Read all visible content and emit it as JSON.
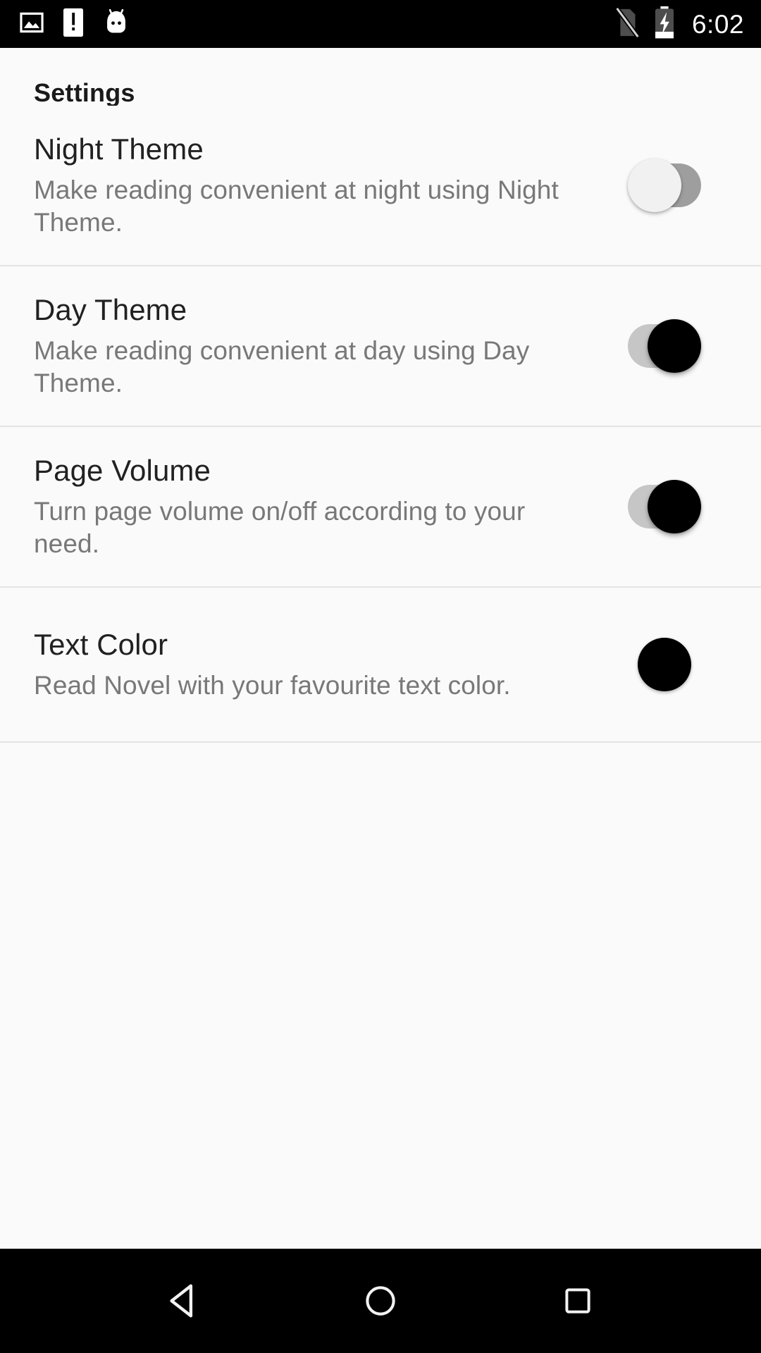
{
  "status_bar": {
    "icons": [
      "image-icon",
      "phone-alert-icon",
      "android-mascot-icon"
    ],
    "no_sim_icon": "no-sim-icon",
    "battery_icon": "battery-charging-icon",
    "time": "6:02",
    "background_color": "#000000",
    "foreground_color": "#ffffff"
  },
  "header": {
    "title": "Settings"
  },
  "settings": {
    "rows": [
      {
        "title": "Night Theme",
        "description": "Make reading convenient at night using Night Theme.",
        "control": "toggle",
        "state": "off"
      },
      {
        "title": "Day Theme",
        "description": "Make reading convenient at day using Day Theme.",
        "control": "toggle",
        "state": "on"
      },
      {
        "title": "Page Volume",
        "description": "Turn page volume on/off according to your need.",
        "control": "toggle",
        "state": "on"
      },
      {
        "title": "Text Color",
        "description": "Read Novel with your favourite text color.",
        "control": "color-swatch",
        "swatch_color": "#000000"
      }
    ]
  },
  "nav_bar": {
    "back_label": "back-button",
    "home_label": "home-button",
    "recents_label": "recents-button",
    "background_color": "#000000"
  },
  "theme": {
    "page_background": "#fafafa",
    "title_color": "#212121",
    "description_color": "#787878",
    "divider_color": "#e4e4e4",
    "toggle_on_thumb": "#000000",
    "toggle_on_track": "#c6c6c6",
    "toggle_off_thumb": "#f1f1f1",
    "toggle_off_track": "#9e9e9e"
  }
}
